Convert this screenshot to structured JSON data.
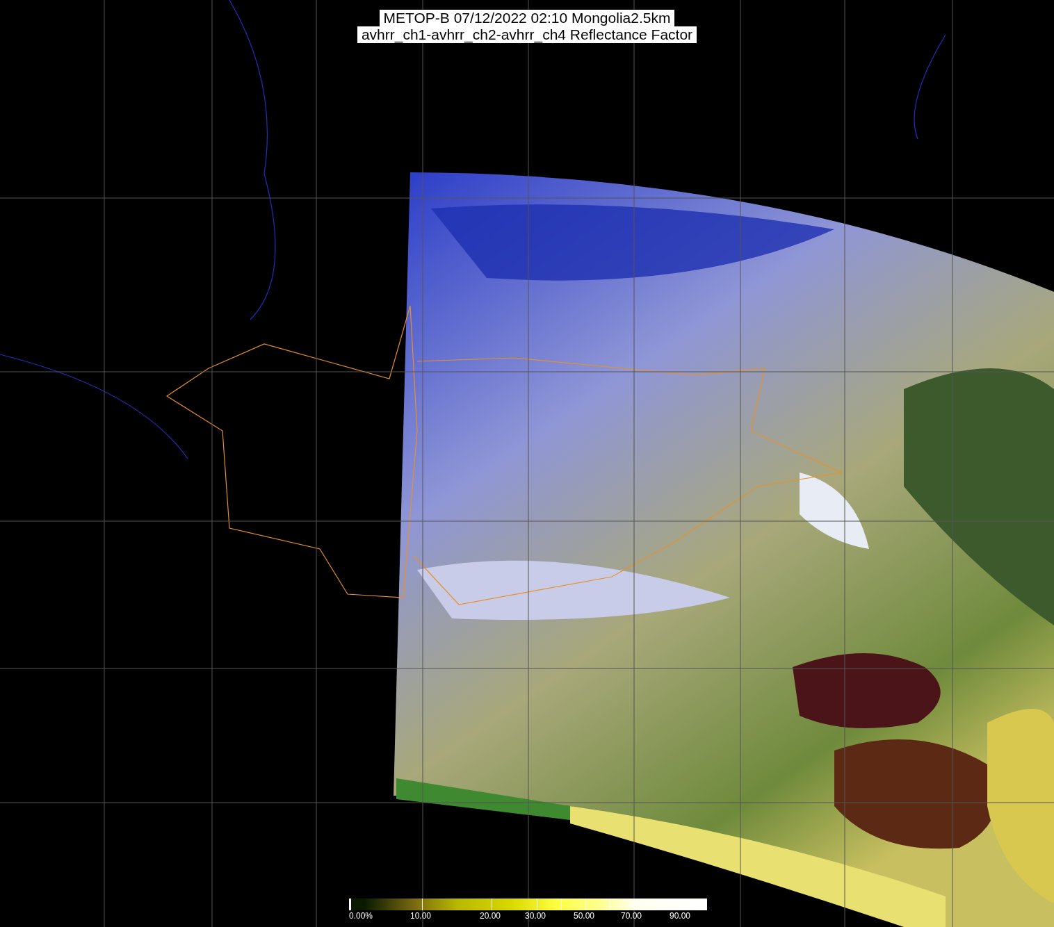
{
  "title": {
    "lines": [
      "METOP-B 07/12/2022 02:10 Mongolia2.5km",
      "avhrr_ch1-avhrr_ch2-avhrr_ch4 Reflectance Factor"
    ]
  },
  "colorbar": {
    "labels": [
      "0.00%",
      "10.00",
      "20.00",
      "30.00",
      "50.00",
      "70.00",
      "90.00"
    ]
  }
}
